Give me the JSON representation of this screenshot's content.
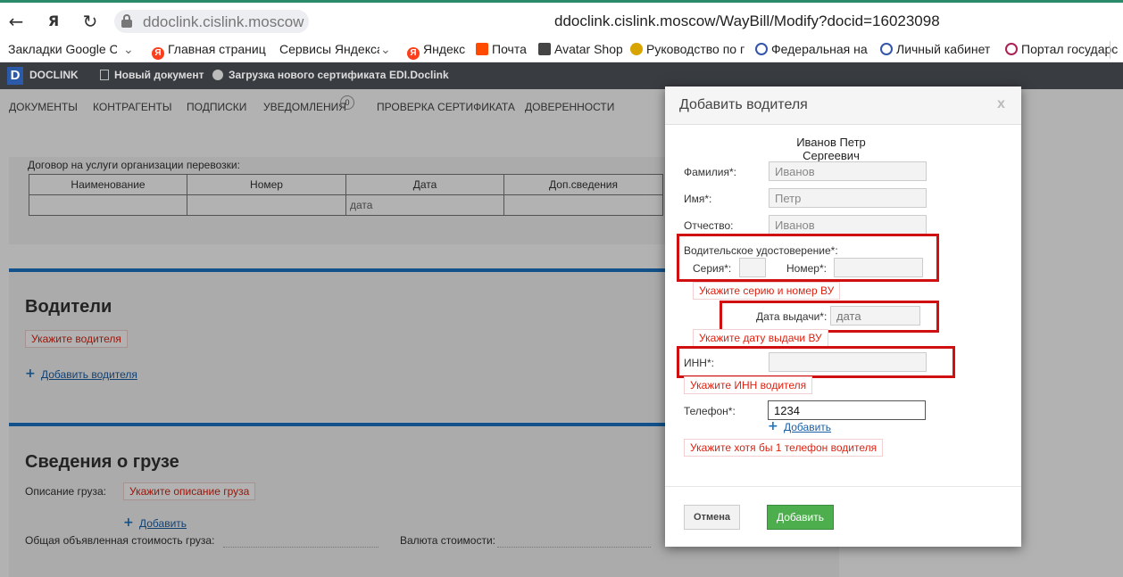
{
  "browser": {
    "host": "ddoclink.cislink.moscow",
    "full_url": "ddoclink.cislink.moscow/WayBill/Modify?docid=16023098",
    "back_icon": "arrow-left-icon",
    "reload_icon": "reload-icon",
    "bookmarks": [
      "Закладки Google Ch",
      "Главная страница",
      "Сервисы Яндекса",
      "Яндекс",
      "Почта",
      "Avatar Shop",
      "Руководство по п",
      "Федеральная нал",
      "Личный кабинет н",
      "Портал государст"
    ]
  },
  "app": {
    "logo_letter": "D",
    "logo_text": "DOCLINK",
    "header_links": [
      "Новый документ",
      "Загрузка нового сертификата",
      "EDI.Doclink"
    ],
    "menu": [
      "ДОКУМЕНТЫ",
      "КОНТРАГЕНТЫ",
      "ПОДПИСКИ",
      "УВЕДОМЛЕНИЯ",
      "ПРОВЕРКА СЕРТИФИКАТА",
      "ДОВЕРЕННОСТИ"
    ],
    "notifications_count": "0"
  },
  "page": {
    "contract_label": "Договор на услуги организации перевозки:",
    "contract_columns": [
      "Наименование",
      "Номер",
      "Дата",
      "Доп.сведения"
    ],
    "contract_date_placeholder": "дата",
    "drivers_title": "Водители",
    "drivers_error": "Укажите водителя",
    "add_driver_link": "Добавить водителя",
    "cargo_title": "Сведения о грузе",
    "cargo_desc_label": "Описание груза:",
    "cargo_desc_error": "Укажите описание груза",
    "cargo_add_link": "Добавить",
    "cargo_value_label": "Общая объявленная стоимость груза:",
    "currency_label": "Валюта стоимости:"
  },
  "modal": {
    "title": "Добавить водителя",
    "close": "x",
    "full_name": "Иванов Петр Сергеевич",
    "surname_label": "Фамилия*:",
    "surname_value": "Иванов",
    "name_label": "Имя*:",
    "name_value": "Петр",
    "patronymic_label": "Отчество:",
    "patronymic_value": "Иванов",
    "license_label": "Водительское удостоверение*:",
    "series_label": "Серия*:",
    "number_label": "Номер*:",
    "license_error": "Укажите серию и номер ВУ",
    "issue_date_label": "Дата выдачи*:",
    "issue_date_placeholder": "дата",
    "issue_date_error": "Укажите дату выдачи ВУ",
    "inn_label": "ИНН*:",
    "inn_error": "Укажите ИНН водителя",
    "phone_label": "Телефон*:",
    "phone_value": "1234",
    "phone_add_link": "Добавить",
    "phone_error": "Укажите хотя бы 1 телефон водителя",
    "cancel_label": "Отмена",
    "submit_label": "Добавить",
    "highlight_color": "#d01010"
  }
}
